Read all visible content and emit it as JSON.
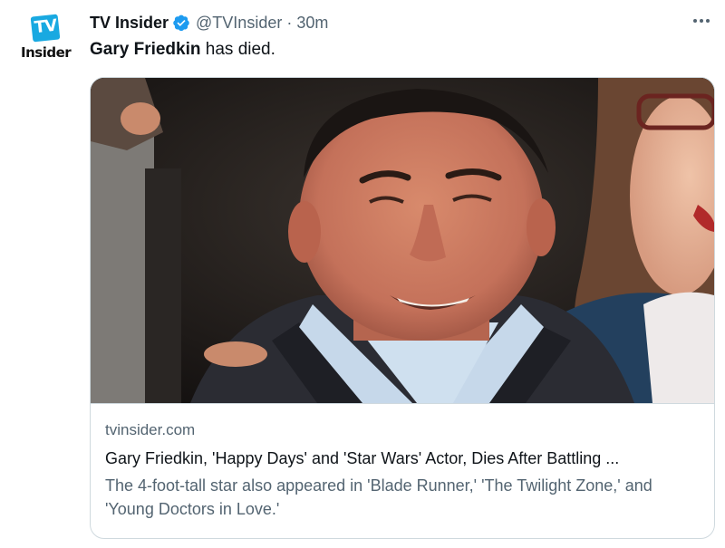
{
  "account": {
    "avatar_line1": "TV",
    "avatar_line2": "Insider",
    "display_name": "TV Insider",
    "handle": "@TVInsider",
    "separator": "·",
    "time": "30m"
  },
  "icons": {
    "verified": "verified-badge-icon",
    "more": "more-options-icon"
  },
  "tweet": {
    "name_bold": "Gary Friedkin",
    "text_rest": " has died."
  },
  "card": {
    "image_subject": "photo-of-smiling-man",
    "domain": "tvinsider.com",
    "title": "Gary Friedkin, 'Happy Days' and 'Star Wars' Actor, Dies After Battling ...",
    "description": "The 4-foot-tall star also appeared in 'Blade Runner,' 'The Twilight Zone,' and 'Young Doctors in Love.'"
  },
  "colors": {
    "brand_blue": "#1d9bf0",
    "logo_blue": "#19a9e1",
    "text_primary": "#0f1419",
    "text_secondary": "#536471",
    "border": "#cfd9de"
  }
}
